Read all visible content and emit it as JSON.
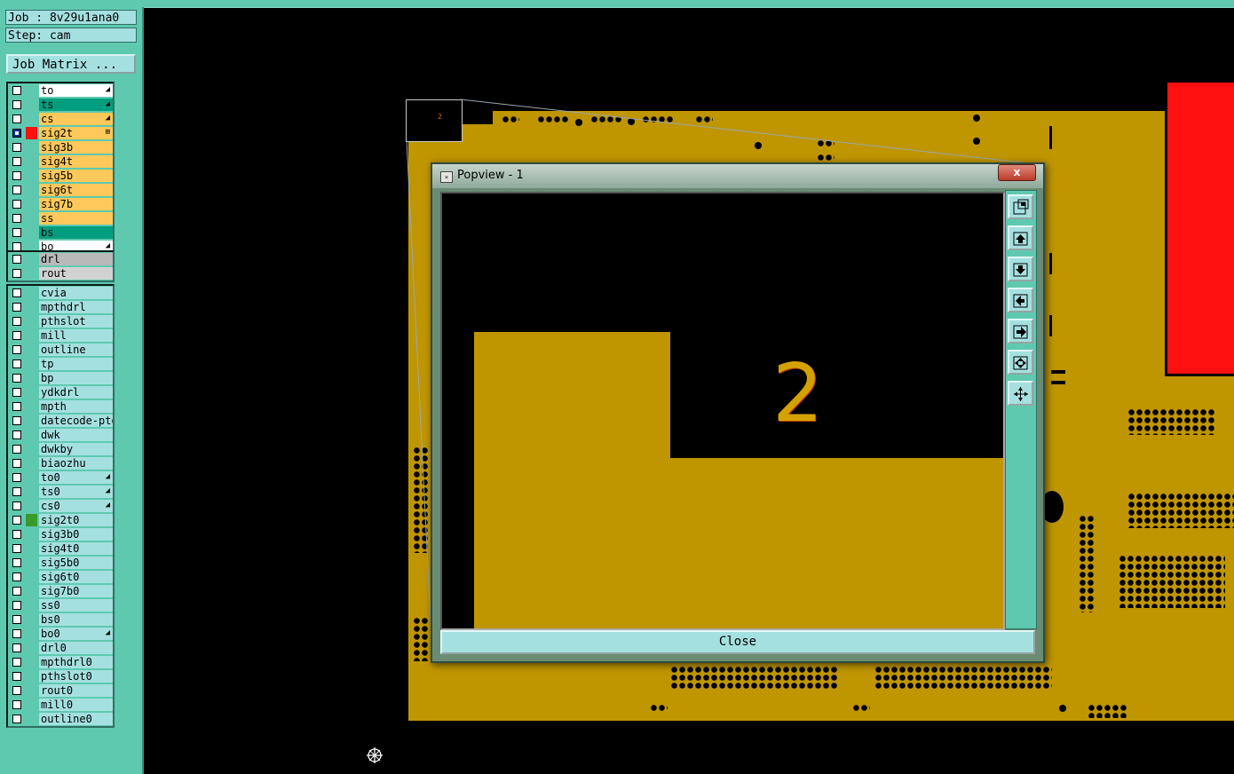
{
  "job_label": "Job : 8v29u1ana0",
  "step_label": "Step: cam",
  "job_matrix_button": "Job Matrix ...",
  "layer_groups": [
    [
      {
        "name": "to",
        "color": "#ffffff",
        "mark": "◢"
      },
      {
        "name": "ts",
        "color": "#009e7e",
        "mark": "◢"
      },
      {
        "name": "cs",
        "color": "#ffc85a",
        "mark": "◢"
      },
      {
        "name": "sig2t",
        "color": "#ffc85a",
        "mark": "⊞",
        "active": true,
        "swatch": "#ff1010"
      },
      {
        "name": "sig3b",
        "color": "#ffc85a"
      },
      {
        "name": "sig4t",
        "color": "#ffc85a"
      },
      {
        "name": "sig5b",
        "color": "#ffc85a"
      },
      {
        "name": "sig6t",
        "color": "#ffc85a"
      },
      {
        "name": "sig7b",
        "color": "#ffc85a"
      },
      {
        "name": "ss",
        "color": "#ffc85a"
      },
      {
        "name": "bs",
        "color": "#009e7e"
      },
      {
        "name": "bo",
        "color": "#ffffff",
        "mark": "◢"
      }
    ],
    [
      {
        "name": "drl",
        "color": "#b9b9b9"
      },
      {
        "name": "rout",
        "color": "#d2d2d2"
      }
    ],
    [
      {
        "name": "cvia",
        "color": "#a5e0e0"
      },
      {
        "name": "mpthdrl",
        "color": "#a5e0e0"
      },
      {
        "name": "pthslot",
        "color": "#a5e0e0"
      },
      {
        "name": "mill",
        "color": "#a5e0e0"
      },
      {
        "name": "outline",
        "color": "#a5e0e0"
      },
      {
        "name": "tp",
        "color": "#a5e0e0"
      },
      {
        "name": "bp",
        "color": "#a5e0e0"
      },
      {
        "name": "ydkdrl",
        "color": "#a5e0e0"
      },
      {
        "name": "mpth",
        "color": "#a5e0e0"
      },
      {
        "name": "datecode-pto",
        "color": "#a5e0e0"
      },
      {
        "name": "dwk",
        "color": "#a5e0e0"
      },
      {
        "name": "dwkby",
        "color": "#a5e0e0"
      },
      {
        "name": "biaozhu",
        "color": "#a5e0e0"
      },
      {
        "name": "to0",
        "color": "#a5e0e0",
        "mark": "◢"
      },
      {
        "name": "ts0",
        "color": "#a5e0e0",
        "mark": "◢"
      },
      {
        "name": "cs0",
        "color": "#a5e0e0",
        "mark": "◢"
      },
      {
        "name": "sig2t0",
        "color": "#a5e0e0",
        "swatch": "#3a9a2a"
      },
      {
        "name": "sig3b0",
        "color": "#a5e0e0"
      },
      {
        "name": "sig4t0",
        "color": "#a5e0e0"
      },
      {
        "name": "sig5b0",
        "color": "#a5e0e0"
      },
      {
        "name": "sig6t0",
        "color": "#a5e0e0"
      },
      {
        "name": "sig7b0",
        "color": "#a5e0e0"
      },
      {
        "name": "ss0",
        "color": "#a5e0e0"
      },
      {
        "name": "bs0",
        "color": "#a5e0e0"
      },
      {
        "name": "bo0",
        "color": "#a5e0e0",
        "mark": "◢"
      },
      {
        "name": "drl0",
        "color": "#a5e0e0"
      },
      {
        "name": "mpthdrl0",
        "color": "#a5e0e0"
      },
      {
        "name": "pthslot0",
        "color": "#a5e0e0"
      },
      {
        "name": "rout0",
        "color": "#a5e0e0"
      },
      {
        "name": "mill0",
        "color": "#a5e0e0"
      },
      {
        "name": "outline0",
        "color": "#a5e0e0"
      }
    ]
  ],
  "zoom_box_label": "2",
  "popup": {
    "title": "Popview - 1",
    "close_x": "x",
    "big_label": "2",
    "close_button": "Close",
    "tools": [
      "zoom-fit-icon",
      "pan-up-icon",
      "pan-down-icon",
      "pan-left-icon",
      "pan-right-icon",
      "zoom-in-icon",
      "zoom-out-icon"
    ]
  },
  "colors": {
    "panel": "#5fc9b0",
    "copper": "#bf9500",
    "active_pad": "#ff1010"
  }
}
